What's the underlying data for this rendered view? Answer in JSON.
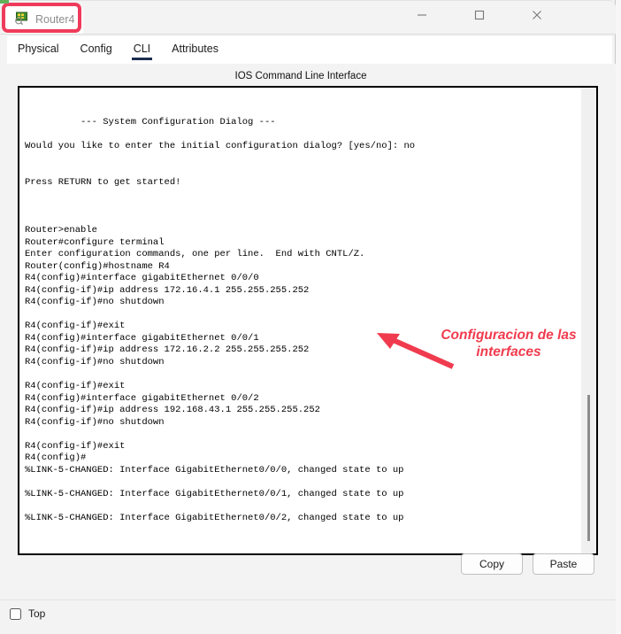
{
  "window": {
    "title": "Router4",
    "title_icon": "router-icon",
    "controls": {
      "minimize": "minimize-icon",
      "maximize": "maximize-icon",
      "close": "close-icon"
    }
  },
  "tabs": [
    {
      "label": "Physical",
      "active": false
    },
    {
      "label": "Config",
      "active": false
    },
    {
      "label": "CLI",
      "active": true
    },
    {
      "label": "Attributes",
      "active": false
    }
  ],
  "panel": {
    "caption": "IOS Command Line Interface"
  },
  "terminal": {
    "content": "\n\n          --- System Configuration Dialog ---\n\nWould you like to enter the initial configuration dialog? [yes/no]: no\n\n\nPress RETURN to get started!\n\n\n\nRouter>enable\nRouter#configure terminal\nEnter configuration commands, one per line.  End with CNTL/Z.\nRouter(config)#hostname R4\nR4(config)#interface gigabitEthernet 0/0/0\nR4(config-if)#ip address 172.16.4.1 255.255.255.252\nR4(config-if)#no shutdown\n\nR4(config-if)#exit\nR4(config)#interface gigabitEthernet 0/0/1\nR4(config-if)#ip address 172.16.2.2 255.255.255.252\nR4(config-if)#no shutdown\n\nR4(config-if)#exit\nR4(config)#interface gigabitEthernet 0/0/2\nR4(config-if)#ip address 192.168.43.1 255.255.255.252\nR4(config-if)#no shutdown\n\nR4(config-if)#exit\nR4(config)#\n%LINK-5-CHANGED: Interface GigabitEthernet0/0/0, changed state to up\n\n%LINK-5-CHANGED: Interface GigabitEthernet0/0/1, changed state to up\n\n%LINK-5-CHANGED: Interface GigabitEthernet0/0/2, changed state to up\n"
  },
  "annotation": {
    "text": "Configuracion de las interfaces",
    "color": "#f03b4e",
    "outline_color": "#ffffff",
    "arrow": "red-arrow-pointing-up-left",
    "highlight_box": "red-rounded-rect-around-title"
  },
  "buttons": {
    "copy": "Copy",
    "paste": "Paste"
  },
  "bottom": {
    "top_checkbox_label": "Top",
    "top_checkbox_checked": false
  }
}
